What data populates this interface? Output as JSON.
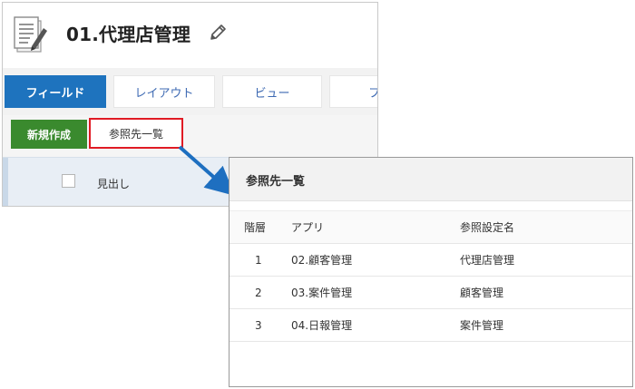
{
  "app": {
    "title": "01.代理店管理",
    "icon": "document-pen-icon",
    "edit_icon": "pencil-icon"
  },
  "tabs": [
    {
      "label": "フィールド",
      "active": true
    },
    {
      "label": "レイアウト",
      "active": false
    },
    {
      "label": "ビュー",
      "active": false
    },
    {
      "label": "フィ",
      "active": false
    }
  ],
  "toolbar": {
    "new_label": "新規作成",
    "ref_label": "参照先一覧"
  },
  "list": {
    "heading": "見出し"
  },
  "dialog": {
    "title": "参照先一覧",
    "columns": {
      "level": "階層",
      "app": "アプリ",
      "setting": "参照設定名"
    },
    "rows": [
      {
        "level": "1",
        "app": "02.顧客管理",
        "setting": "代理店管理"
      },
      {
        "level": "2",
        "app": "03.案件管理",
        "setting": "顧客管理"
      },
      {
        "level": "3",
        "app": "04.日報管理",
        "setting": "案件管理"
      }
    ]
  },
  "colors": {
    "active_tab": "#1e73be",
    "new_button": "#3a8a2e",
    "highlight_border": "#e01b24",
    "arrow": "#1e6fc0"
  }
}
